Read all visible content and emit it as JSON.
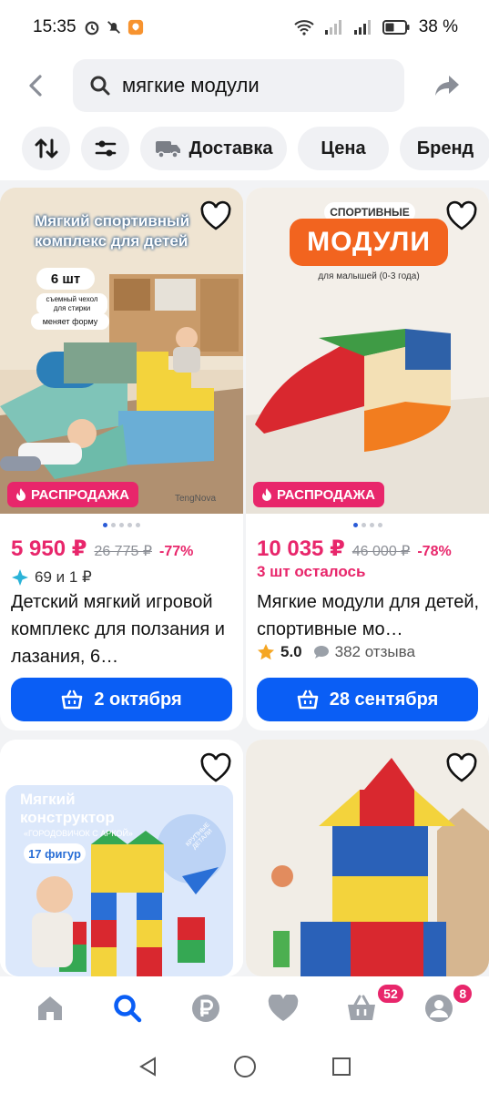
{
  "status_bar": {
    "time": "15:35",
    "battery": "38 %"
  },
  "search": {
    "query": "мягкие модули"
  },
  "filters": [
    {
      "label": "Доставка"
    },
    {
      "label": "Цена"
    },
    {
      "label": "Бренд"
    }
  ],
  "products": [
    {
      "image_text": {
        "headline": "Мягкий спортивный комплекс для детей",
        "count": "6 шт",
        "tag1": "съемный чехол для стирки",
        "tag2": "меняет форму",
        "brand": "TengNova"
      },
      "badge": "РАСПРОДАЖА",
      "price": "5 950 ₽",
      "old_price": "26 775 ₽",
      "discount": "-77%",
      "bonus": "69 и 1 ₽",
      "title": "Детский мягкий игровой комплекс для ползания и лазания, 6…",
      "delivery": "2 октября"
    },
    {
      "image_text": {
        "top": "СПОРТИВНЫЕ",
        "main": "МОДУЛИ",
        "sub": "для малышей (0-3 года)"
      },
      "badge": "РАСПРОДАЖА",
      "price": "10 035 ₽",
      "old_price": "46 000 ₽",
      "discount": "-78%",
      "stock": "3 шт осталось",
      "title": "Мягкие модули для детей, спортивные мо…",
      "rating": "5.0",
      "reviews": "382 отзыва",
      "delivery": "28 сентября"
    },
    {
      "image_text": {
        "headline": "Мягкий конструктор",
        "sub": "«ГОРОДОВИЧОК С АРКОЙ»",
        "count": "17 фигур",
        "round": "КРУПНЫЕ ДЕТАЛИ"
      }
    },
    {}
  ],
  "bottom_nav": {
    "cart_badge": "52",
    "profile_badge": "8"
  },
  "colors": {
    "accent": "#0a5ef5",
    "sale": "#e8266b"
  }
}
